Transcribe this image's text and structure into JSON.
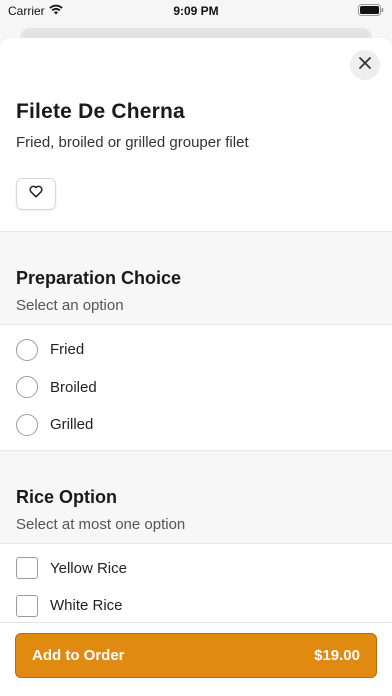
{
  "status_bar": {
    "carrier": "Carrier",
    "time": "9:09 PM",
    "wifi_icon": "wifi-icon",
    "battery_icon": "battery-icon"
  },
  "item": {
    "title": "Filete De Cherna",
    "description": "Fried, broiled or grilled grouper filet",
    "favorite_icon": "heart-icon"
  },
  "sections": [
    {
      "title": "Preparation Choice",
      "subtitle": "Select an option",
      "input_type": "radio",
      "options": [
        "Fried",
        "Broiled",
        "Grilled"
      ]
    },
    {
      "title": "Rice Option",
      "subtitle": "Select at most one option",
      "input_type": "checkbox",
      "options": [
        "Yellow Rice",
        "White Rice"
      ]
    }
  ],
  "footer": {
    "button_label": "Add to Order",
    "price": "$19.00"
  },
  "colors": {
    "accent": "#e08a12",
    "background": "#f6f6f6"
  }
}
